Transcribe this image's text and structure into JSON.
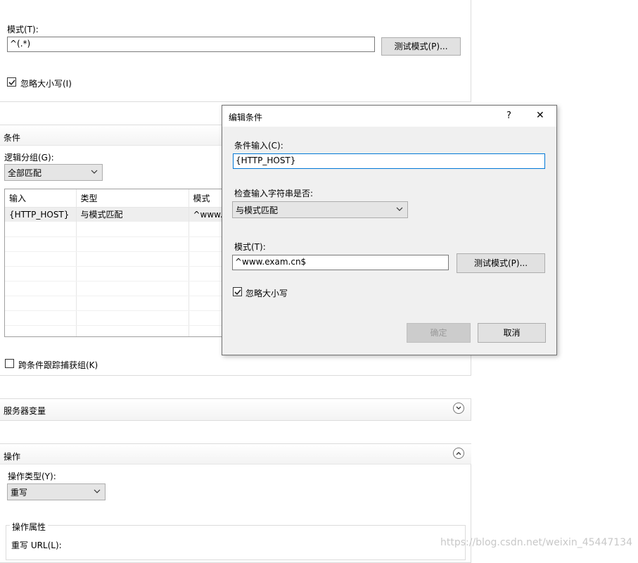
{
  "top_section": {
    "pattern_label": "模式(T):",
    "pattern_value": "^(.*)",
    "test_button": "测试模式(P)...",
    "ignore_case_label": "忽略大小写(I)",
    "ignore_case_checked": true
  },
  "conditions": {
    "header": "条件",
    "logic_group_label": "逻辑分组(G):",
    "logic_group_value": "全部匹配",
    "columns": [
      "输入",
      "类型",
      "模式"
    ],
    "rows": [
      [
        "{HTTP_HOST}",
        "与模式匹配",
        "^www.e"
      ]
    ],
    "track_label": "跨条件跟踪捕获组(K)",
    "track_checked": false
  },
  "server_variables": {
    "header": "服务器变量"
  },
  "action": {
    "header": "操作",
    "type_label": "操作类型(Y):",
    "type_value": "重写",
    "properties_label": "操作属性",
    "rewrite_url_label": "重写 URL(L):"
  },
  "dialog": {
    "title": "编辑条件",
    "help": "?",
    "close": "✕",
    "input_label": "条件输入(C):",
    "input_value": "{HTTP_HOST}",
    "check_label": "检查输入字符串是否:",
    "check_value": "与模式匹配",
    "pattern_label": "模式(T):",
    "pattern_value": "^www.exam.cn$",
    "test_button": "测试模式(P)...",
    "ignore_case_label": "忽略大小写",
    "ignore_case_checked": true,
    "ok_button": "确定",
    "cancel_button": "取消"
  },
  "watermark": "https://blog.csdn.net/weixin_45447134"
}
